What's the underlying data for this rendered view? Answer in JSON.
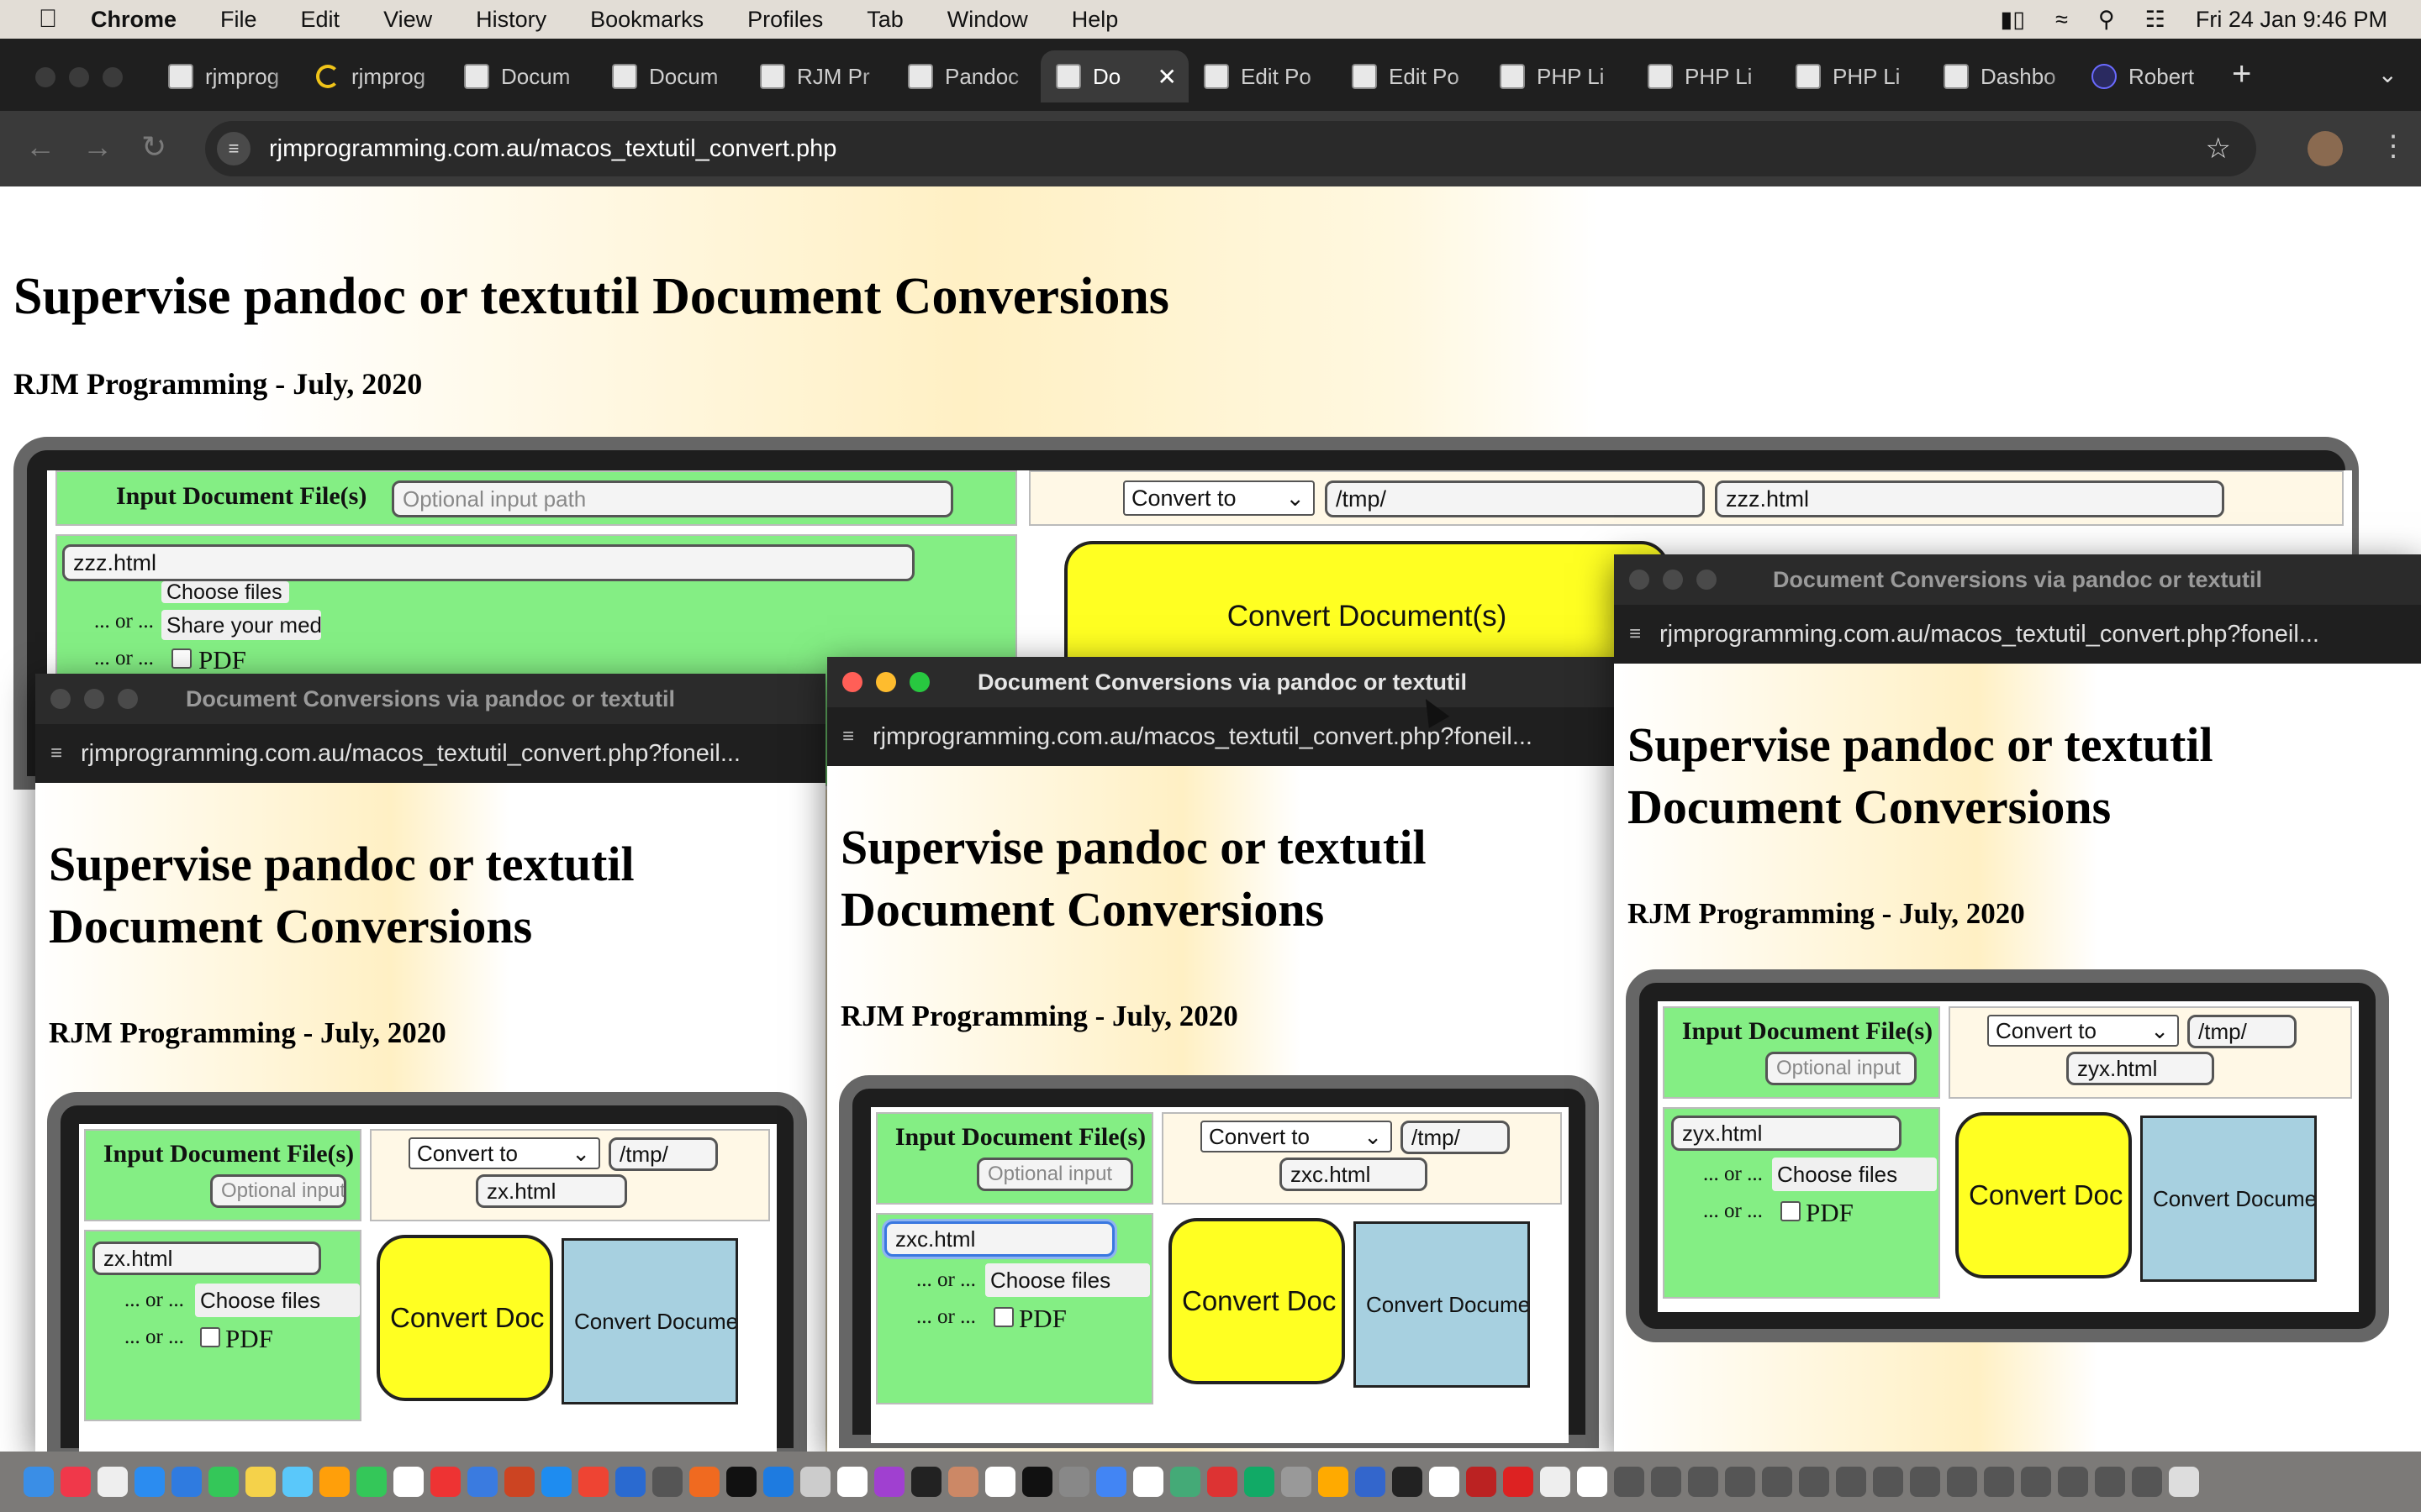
{
  "menubar": {
    "app": "Chrome",
    "items": [
      "File",
      "Edit",
      "View",
      "History",
      "Bookmarks",
      "Profiles",
      "Tab",
      "Window",
      "Help"
    ],
    "clock": "Fri 24 Jan  9:46 PM"
  },
  "tabs": [
    {
      "label": "rjmprog"
    },
    {
      "label": "rjmprog"
    },
    {
      "label": "Docum"
    },
    {
      "label": "Docum"
    },
    {
      "label": "RJM Pr"
    },
    {
      "label": "Pandoc"
    },
    {
      "label": "Do"
    },
    {
      "label": "Edit Po"
    },
    {
      "label": "Edit Po"
    },
    {
      "label": "PHP Li"
    },
    {
      "label": "PHP Li"
    },
    {
      "label": "PHP Li"
    },
    {
      "label": "Dashbo"
    },
    {
      "label": "Robert"
    }
  ],
  "address": {
    "url": "rjmprogramming.com.au/macos_textutil_convert.php"
  },
  "main": {
    "title": "Supervise pandoc or textutil Document Conversions",
    "subtitle": "RJM Programming - July, 2020",
    "input_label": "Input Document File(s)",
    "input_placeholder": "Optional input path",
    "input_value": "zzz.html",
    "choose_label": "Choose files",
    "share_label": "Share your med",
    "or1": "... or ...",
    "or2": "... or ...",
    "pdf": "PDF",
    "convert_select": "Convert to",
    "dir": "/tmp/",
    "outfile": "zzz.html",
    "convert_btn": "Convert Document(s)"
  },
  "popups": [
    {
      "title": "Document Conversions via pandoc or textutil",
      "url": "rjmprogramming.com.au/macos_textutil_convert.php?foneil...",
      "h1": "Supervise pandoc or textutil Document Conversions",
      "h3": "RJM Programming - July, 2020",
      "input_label": "Input Document File(s)",
      "input_placeholder": "Optional input",
      "convert_select": "Convert to",
      "dir": "/tmp/",
      "outfile": "zx.html",
      "infile": "zx.html",
      "or": "... or ...",
      "choose": "Choose files",
      "pdf": "PDF",
      "yellow": "Convert Doc",
      "blue": "Convert Docume"
    },
    {
      "title": "Document Conversions via pandoc or textutil",
      "url": "rjmprogramming.com.au/macos_textutil_convert.php?foneil...",
      "h1": "Supervise pandoc or textutil Document Conversions",
      "h3": "RJM Programming - July, 2020",
      "input_label": "Input Document File(s)",
      "input_placeholder": "Optional input",
      "convert_select": "Convert to",
      "dir": "/tmp/",
      "outfile": "zxc.html",
      "infile": "zxc.html",
      "or": "... or ...",
      "choose": "Choose files",
      "pdf": "PDF",
      "yellow": "Convert Doc",
      "blue": "Convert Docume"
    },
    {
      "title": "Document Conversions via pandoc or textutil",
      "url": "rjmprogramming.com.au/macos_textutil_convert.php?foneil...",
      "h1": "Supervise pandoc or textutil Document Conversions",
      "h3": "RJM Programming - July, 2020",
      "input_label": "Input Document File(s)",
      "input_placeholder": "Optional input",
      "convert_select": "Convert to",
      "dir": "/tmp/",
      "outfile": "zyx.html",
      "infile": "zyx.html",
      "or": "... or ...",
      "choose": "Choose files",
      "pdf": "PDF",
      "yellow": "Convert Doc",
      "blue": "Convert Docume"
    }
  ],
  "colors": {
    "green_cell": "#84ee84",
    "yellow_button": "#ffff22",
    "blue_button": "#a7d0e0"
  }
}
